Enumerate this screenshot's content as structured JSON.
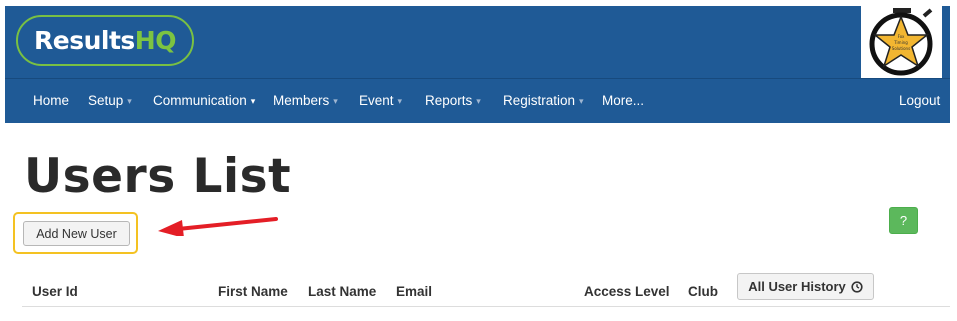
{
  "header": {
    "logo_main": "Results",
    "logo_accent": "HQ",
    "badge_lines": [
      "Fox",
      "Timing",
      "Solutions"
    ]
  },
  "nav": {
    "items": [
      {
        "label": "Home",
        "caret": ""
      },
      {
        "label": "Setup",
        "caret": "▾"
      },
      {
        "label": "Communication",
        "caret": "▾"
      },
      {
        "label": "Members",
        "caret": "▾"
      },
      {
        "label": "Event",
        "caret": "▾"
      },
      {
        "label": "Reports",
        "caret": "▾"
      },
      {
        "label": "Registration",
        "caret": "▾"
      },
      {
        "label": "More...",
        "caret": ""
      }
    ],
    "logout": "Logout"
  },
  "main": {
    "title": "Users List",
    "add_button": "Add New User",
    "help_button": "?",
    "history_button": "All User History"
  },
  "table": {
    "columns": [
      "User Id",
      "First Name",
      "Last Name",
      "Email",
      "Access Level",
      "Club"
    ]
  },
  "colors": {
    "brand_blue": "#1f5a96",
    "logo_green": "#7cc441",
    "highlight_yellow": "#f4c222",
    "arrow_red": "#e41e26",
    "help_green": "#5cb85c"
  }
}
